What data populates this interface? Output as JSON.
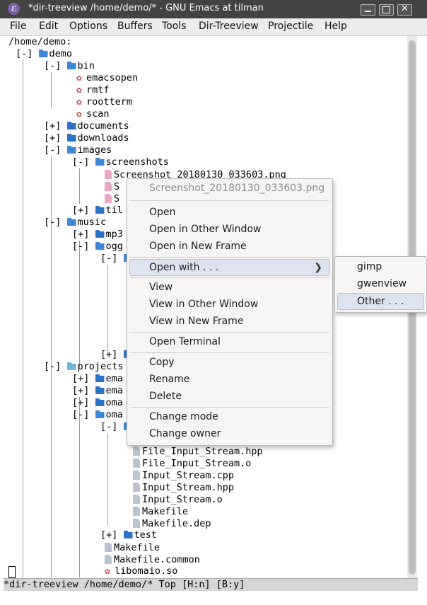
{
  "window": {
    "title": "*dir-treeview /home/demo/* - GNU Emacs at tilman",
    "logo_letter": "ℰ"
  },
  "menubar": [
    "File",
    "Edit",
    "Options",
    "Buffers",
    "Tools",
    "Dir-Treeview",
    "Projectile",
    "Help"
  ],
  "tree": [
    {
      "text": "/home/demo:",
      "icon": "none",
      "name": "root-path"
    },
    {
      "text": "[-] ",
      "icon": "folder-open",
      "label": "demo"
    },
    {
      "text": "[-] ",
      "icon": "folder-open",
      "label": "bin"
    },
    {
      "text": "",
      "icon": "gear",
      "label": "emacsopen"
    },
    {
      "text": "",
      "icon": "gear",
      "label": "rmtf"
    },
    {
      "text": "",
      "icon": "gear",
      "label": "rootterm"
    },
    {
      "text": "",
      "icon": "gear",
      "label": "scan"
    },
    {
      "text": "[+] ",
      "icon": "folder",
      "label": "documents"
    },
    {
      "text": "[+] ",
      "icon": "folder",
      "label": "downloads"
    },
    {
      "text": "[-] ",
      "icon": "folder-open",
      "label": "images"
    },
    {
      "text": "[-] ",
      "icon": "folder-open",
      "label": "screenshots"
    },
    {
      "text": "",
      "icon": "image-file",
      "label": "Screenshot_20180130_033603.png"
    },
    {
      "text": "",
      "icon": "image-file",
      "label": "S"
    },
    {
      "text": "",
      "icon": "image-file",
      "label": "S"
    },
    {
      "text": "[+] ",
      "icon": "folder",
      "label": "til"
    },
    {
      "text": "[-] ",
      "icon": "folder-open",
      "label": "music"
    },
    {
      "text": "[+] ",
      "icon": "folder",
      "label": "mp3"
    },
    {
      "text": "[-] ",
      "icon": "folder-open",
      "label": "ogg"
    },
    {
      "text": "[-] ",
      "icon": "folder-open",
      "label": ""
    },
    {
      "text": "[+] ",
      "icon": "folder",
      "label": ""
    },
    {
      "text": "[-] ",
      "icon": "folder-open",
      "label": "projects"
    },
    {
      "text": "[+] ",
      "icon": "folder",
      "label": "ema"
    },
    {
      "text": "[+] ",
      "icon": "folder",
      "label": "ema"
    },
    {
      "text": "[+] ",
      "icon": "folder",
      "label": "oma"
    },
    {
      "text": "[-] ",
      "icon": "folder-open",
      "label": "oma"
    },
    {
      "text": "[-] ",
      "icon": "folder-open",
      "label": ""
    },
    {
      "text": "",
      "icon": "file",
      "label": "File_Input_Stream.hpp"
    },
    {
      "text": "",
      "icon": "file",
      "label": "File_Input_Stream.o"
    },
    {
      "text": "",
      "icon": "file",
      "label": "Input_Stream.cpp"
    },
    {
      "text": "",
      "icon": "file",
      "label": "Input_Stream.hpp"
    },
    {
      "text": "",
      "icon": "file",
      "label": "Input_Stream.o"
    },
    {
      "text": "",
      "icon": "file",
      "label": "Makefile"
    },
    {
      "text": "",
      "icon": "file",
      "label": "Makefile.dep"
    },
    {
      "text": "[+] ",
      "icon": "folder",
      "label": "test"
    },
    {
      "text": "",
      "icon": "file",
      "label": "Makefile"
    },
    {
      "text": "",
      "icon": "file",
      "label": "Makefile.common"
    },
    {
      "text": "",
      "icon": "gear",
      "label": "libomaio.so"
    }
  ],
  "modeline": "*dir-treeview /home/demo/* Top [H:n] [B:y]",
  "context_menu": {
    "header": "Screenshot_20180130_033603.png",
    "items": [
      "Open",
      "Open in Other Window",
      "Open in New Frame",
      "Open with . . .",
      "View",
      "View in Other Window",
      "View in New Frame",
      "Open Terminal",
      "Copy",
      "Rename",
      "Delete",
      "Change mode",
      "Change owner"
    ],
    "submenu_arrow": "❯"
  },
  "submenu": [
    "gimp",
    "gwenview",
    "Other . . ."
  ]
}
